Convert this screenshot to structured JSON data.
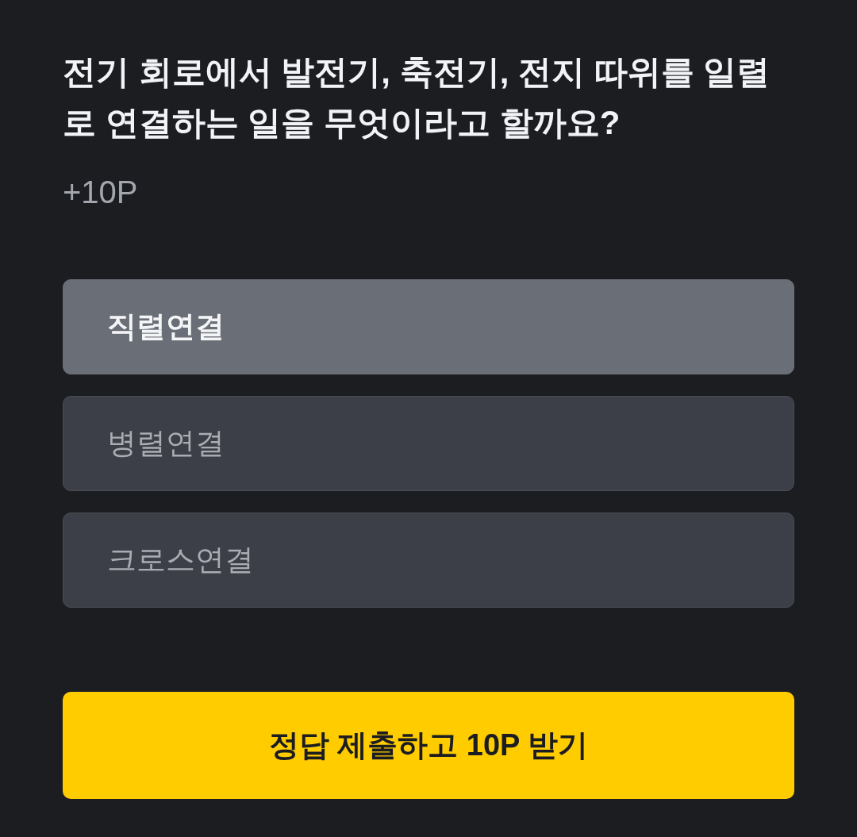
{
  "question": {
    "text": "전기 회로에서 발전기, 축전기, 전지 따위를 일렬로 연결하는 일을 무엇이라고 할까요?",
    "points": "+10P"
  },
  "options": [
    {
      "label": "직렬연결",
      "selected": true
    },
    {
      "label": "병렬연결",
      "selected": false
    },
    {
      "label": "크로스연결",
      "selected": false
    }
  ],
  "submit_button": {
    "label": "정답 제출하고 10P 받기"
  }
}
